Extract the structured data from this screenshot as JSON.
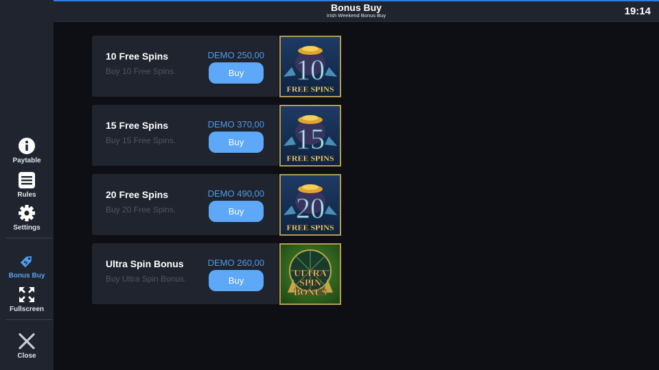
{
  "header": {
    "title": "Bonus Buy",
    "subtitle": "Irish Weekend Bonus Buy",
    "clock": "19:14"
  },
  "sidebar": {
    "items": [
      {
        "label": "Paytable",
        "icon": "info-icon"
      },
      {
        "label": "Rules",
        "icon": "list-icon"
      },
      {
        "label": "Settings",
        "icon": "gear-icon"
      },
      {
        "label": "Bonus Buy",
        "icon": "tag-icon",
        "active": true
      },
      {
        "label": "Fullscreen",
        "icon": "fullscreen-icon"
      },
      {
        "label": "Close",
        "icon": "close-icon"
      }
    ]
  },
  "offers": [
    {
      "name": "10 Free Spins",
      "description": "Buy 10 Free Spins.",
      "price": "DEMO 250,00",
      "button": "Buy",
      "badge_number": "10",
      "badge_text": "FREE SPINS"
    },
    {
      "name": "15 Free Spins",
      "description": "Buy 15 Free Spins.",
      "price": "DEMO 370,00",
      "button": "Buy",
      "badge_number": "15",
      "badge_text": "FREE SPINS"
    },
    {
      "name": "20 Free Spins",
      "description": "Buy 20 Free Spins.",
      "price": "DEMO 490,00",
      "button": "Buy",
      "badge_number": "20",
      "badge_text": "FREE SPINS"
    },
    {
      "name": "Ultra Spin Bonus",
      "description": "Buy Ultra Spin Bonus.",
      "price": "DEMO 260,00",
      "button": "Buy",
      "badge_line1": "ULTRA",
      "badge_line2": "SPIN",
      "badge_line3": "BONUS"
    }
  ],
  "colors": {
    "accent": "#5ea8f8",
    "panel": "#1f242e",
    "background": "#0d0f14",
    "badge_border": "#b79b4e"
  }
}
